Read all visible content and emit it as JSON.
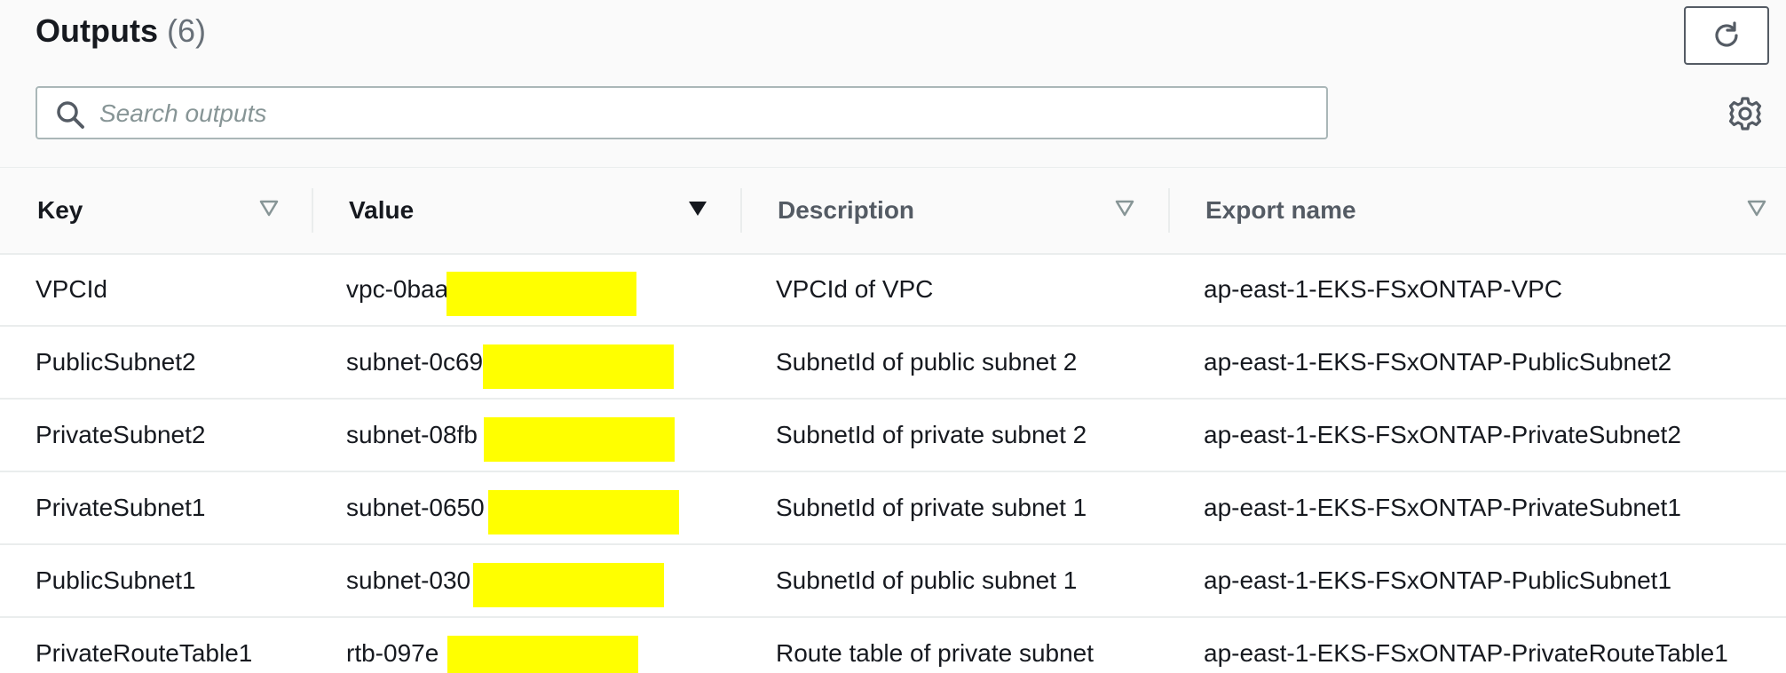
{
  "outputs": {
    "title": "Outputs",
    "count": "(6)",
    "refresh_icon": "refresh-icon",
    "settings_icon": "gear-icon",
    "search": {
      "placeholder": "Search outputs",
      "value": "",
      "icon": "search-icon"
    },
    "columns": [
      {
        "label": "Key",
        "sort": "sortable"
      },
      {
        "label": "Value",
        "sort": "sorted-descending"
      },
      {
        "label": "Description",
        "sort": "sortable"
      },
      {
        "label": "Export name",
        "sort": "sortable"
      }
    ],
    "rows": [
      {
        "key": "VPCId",
        "value": "vpc-0baa",
        "description": "VPCId of VPC",
        "export_name": "ap-east-1-EKS-FSxONTAP-VPC",
        "value_redacted": true
      },
      {
        "key": "PublicSubnet2",
        "value": "subnet-0c69",
        "description": "SubnetId of public subnet 2",
        "export_name": "ap-east-1-EKS-FSxONTAP-PublicSubnet2",
        "value_redacted": true
      },
      {
        "key": "PrivateSubnet2",
        "value": "subnet-08fb",
        "description": "SubnetId of private subnet 2",
        "export_name": "ap-east-1-EKS-FSxONTAP-PrivateSubnet2",
        "value_redacted": true
      },
      {
        "key": "PrivateSubnet1",
        "value": "subnet-0650",
        "description": "SubnetId of private subnet 1",
        "export_name": "ap-east-1-EKS-FSxONTAP-PrivateSubnet1",
        "value_redacted": true
      },
      {
        "key": "PublicSubnet1",
        "value": "subnet-030",
        "description": "SubnetId of public subnet 1",
        "export_name": "ap-east-1-EKS-FSxONTAP-PublicSubnet1",
        "value_redacted": true
      },
      {
        "key": "PrivateRouteTable1",
        "value": "rtb-097e",
        "description": "Route table of private subnet",
        "export_name": "ap-east-1-EKS-FSxONTAP-PrivateRouteTable1",
        "value_redacted": true
      }
    ]
  },
  "colors": {
    "redaction": "#ffff00",
    "text": "#16191f",
    "muted": "#687078",
    "border": "#eaeded"
  }
}
